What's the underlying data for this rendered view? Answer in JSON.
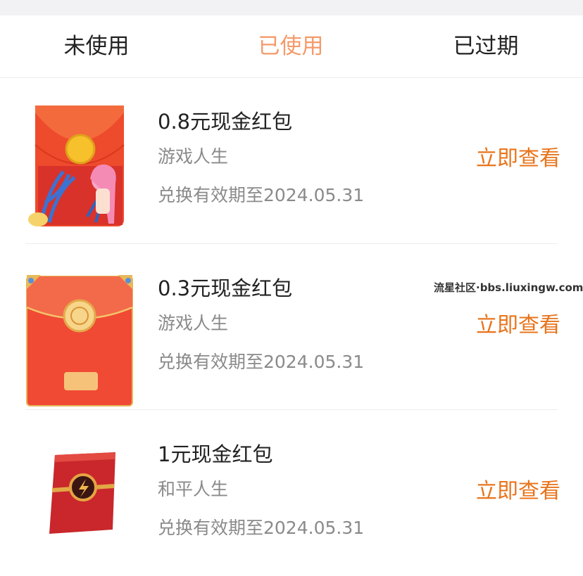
{
  "tabs": [
    {
      "label": "未使用"
    },
    {
      "label": "已使用"
    },
    {
      "label": "已过期"
    }
  ],
  "active_tab_color": "#f59a6b",
  "action_color": "#e8741c",
  "items": [
    {
      "title": "0.8元现金红包",
      "game": "游戏人生",
      "expiry": "兑换有效期至2024.05.31",
      "action": "立即查看",
      "icon": "anime-red-envelope-icon"
    },
    {
      "title": "0.3元现金红包",
      "game": "游戏人生",
      "expiry": "兑换有效期至2024.05.31",
      "action": "立即查看",
      "icon": "game-red-envelope-icon"
    },
    {
      "title": "1元现金红包",
      "game": "和平人生",
      "expiry": "兑换有效期至2024.05.31",
      "action": "立即查看",
      "icon": "lightning-red-envelope-icon"
    }
  ],
  "watermark": "流星社区·bbs.liuxingw.com"
}
